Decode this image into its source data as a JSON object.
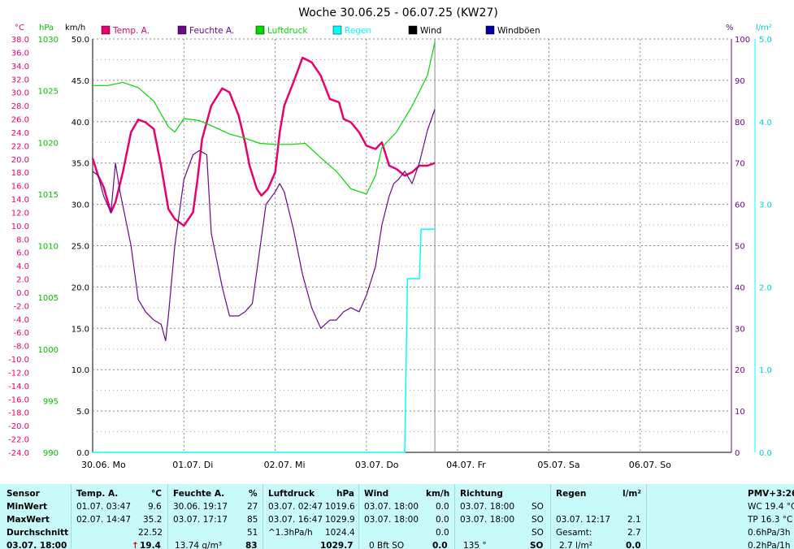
{
  "chart_data": {
    "type": "line",
    "title": "Woche 30.06.25 - 06.07.25 (KW27)",
    "axes": {
      "temperature": {
        "unit": "°C",
        "min": -24,
        "max": 38,
        "ticks": [
          "38.0",
          "36.0",
          "34.0",
          "32.0",
          "30.0",
          "28.0",
          "26.0",
          "24.0",
          "22.0",
          "20.0",
          "18.0",
          "16.0",
          "14.0",
          "12.0",
          "10.0",
          "8.0",
          "6.0",
          "4.0",
          "2.0",
          "0.0",
          "-2.0",
          "-4.0",
          "-6.0",
          "-8.0",
          "-10.0",
          "-12.0",
          "-14.0",
          "-16.0",
          "-18.0",
          "-20.0",
          "-22.0",
          "-24.0"
        ]
      },
      "pressure": {
        "unit": "hPa",
        "min": 990,
        "max": 1030,
        "ticks": [
          "1030",
          "1025",
          "1020",
          "1015",
          "1010",
          "1005",
          "1000",
          "995",
          "990"
        ]
      },
      "wind": {
        "unit": "km/h",
        "min": 0,
        "max": 50,
        "ticks": [
          "50.0",
          "45.0",
          "40.0",
          "35.0",
          "30.0",
          "25.0",
          "20.0",
          "15.0",
          "10.0",
          "5.0",
          "0.0"
        ]
      },
      "humidity": {
        "unit": "%",
        "min": 0,
        "max": 100,
        "ticks": [
          "100",
          "90",
          "80",
          "70",
          "60",
          "50",
          "40",
          "30",
          "20",
          "10",
          "0"
        ]
      },
      "rain": {
        "unit": "l/m²",
        "min": 0,
        "max": 5,
        "ticks": [
          "5.0",
          "4.0",
          "3.0",
          "2.0",
          "1.0",
          "0.0"
        ]
      }
    },
    "x_labels": [
      "30.06. Mo",
      "01.07. Di",
      "02.07. Mi",
      "03.07. Do",
      "04.07. Fr",
      "05.07. Sa",
      "06.07. So"
    ],
    "legend": [
      {
        "name": "Temp. A.",
        "color": "#e8006e"
      },
      {
        "name": "Feuchte A.",
        "color": "#6a0a8a"
      },
      {
        "name": "Luftdruck",
        "color": "#00d800"
      },
      {
        "name": "Regen",
        "color": "#00ffff"
      },
      {
        "name": "Wind",
        "color": "#000000"
      },
      {
        "name": "Windböen",
        "color": "#0000a0"
      }
    ],
    "series": [
      {
        "name": "Temp. A.",
        "axis": "temperature",
        "x": [
          0,
          0.06,
          0.12,
          0.2,
          0.25,
          0.33,
          0.42,
          0.5,
          0.58,
          0.67,
          0.75,
          0.83,
          0.9,
          1.0,
          1.1,
          1.15,
          1.2,
          1.3,
          1.42,
          1.5,
          1.6,
          1.67,
          1.72,
          1.8,
          1.85,
          1.92,
          2.0,
          2.05,
          2.1,
          2.2,
          2.3,
          2.4,
          2.5,
          2.6,
          2.7,
          2.75,
          2.83,
          2.92,
          3.0,
          3.1,
          3.17,
          3.25,
          3.33,
          3.42,
          3.5,
          3.58,
          3.67,
          3.75
        ],
        "y": [
          20.1,
          17.5,
          15.8,
          12.0,
          13.5,
          18.0,
          24.0,
          25.9,
          25.5,
          24.5,
          19.0,
          12.5,
          11.0,
          10.0,
          12.0,
          17.0,
          23.0,
          28.0,
          30.6,
          30.0,
          26.5,
          22.5,
          19.0,
          15.5,
          14.5,
          15.5,
          18.0,
          24.0,
          28.0,
          31.5,
          35.2,
          34.5,
          32.5,
          29.0,
          28.5,
          26.0,
          25.5,
          24.0,
          22.0,
          21.5,
          22.5,
          19.0,
          18.5,
          17.5,
          18.0,
          19.0,
          19.0,
          19.4
        ]
      },
      {
        "name": "Feuchte A.",
        "axis": "humidity",
        "x": [
          0,
          0.06,
          0.12,
          0.2,
          0.25,
          0.3,
          0.42,
          0.5,
          0.58,
          0.67,
          0.75,
          0.8,
          0.83,
          0.9,
          1.0,
          1.1,
          1.17,
          1.25,
          1.3,
          1.42,
          1.5,
          1.6,
          1.67,
          1.75,
          1.8,
          1.9,
          2.0,
          2.05,
          2.1,
          2.2,
          2.3,
          2.4,
          2.5,
          2.6,
          2.67,
          2.75,
          2.83,
          2.92,
          3.0,
          3.1,
          3.17,
          3.25,
          3.3,
          3.35,
          3.42,
          3.5,
          3.58,
          3.67,
          3.75
        ],
        "y": [
          68,
          67,
          62,
          58,
          70,
          63,
          50,
          37,
          34,
          32,
          31,
          27,
          33,
          50,
          66,
          72,
          73,
          72,
          53,
          40,
          33,
          33,
          34,
          36,
          44,
          60,
          63,
          65,
          63,
          54,
          43,
          35,
          30,
          32,
          32,
          34,
          35,
          34,
          38,
          45,
          55,
          62,
          65,
          66,
          68,
          65,
          70,
          78,
          83
        ]
      },
      {
        "name": "Luftdruck",
        "axis": "pressure",
        "x": [
          0,
          0.17,
          0.33,
          0.5,
          0.67,
          0.83,
          0.9,
          1.0,
          1.17,
          1.33,
          1.5,
          1.67,
          1.83,
          2.0,
          2.17,
          2.33,
          2.5,
          2.67,
          2.83,
          3.0,
          3.1,
          3.17,
          3.33,
          3.5,
          3.67,
          3.75
        ],
        "y": [
          1025.5,
          1025.5,
          1025.8,
          1025.3,
          1024.0,
          1021.5,
          1021.0,
          1022.3,
          1022.1,
          1021.5,
          1020.8,
          1020.4,
          1019.9,
          1019.8,
          1019.8,
          1019.9,
          1018.5,
          1017.2,
          1015.5,
          1015.0,
          1016.8,
          1019.5,
          1021.0,
          1023.5,
          1026.5,
          1029.7
        ]
      },
      {
        "name": "Regen",
        "axis": "rain",
        "x": [
          0,
          3.42,
          3.45,
          3.5,
          3.58,
          3.6,
          3.75
        ],
        "y": [
          0,
          0,
          2.1,
          2.1,
          2.1,
          2.7,
          2.7
        ]
      }
    ]
  },
  "header": {
    "temp_unit": "°C",
    "pressure_unit": "hPa",
    "wind_unit": "km/h",
    "humidity_unit": "%",
    "rain_unit": "l/m²"
  },
  "table": {
    "row_labels": {
      "sensor": "Sensor",
      "min": "MinWert",
      "max": "MaxWert",
      "avg": "Durchschnitt",
      "current": "03.07. 18:00"
    },
    "temp": {
      "title": "Temp. A.",
      "unit": "°C",
      "min_time": "01.07. 03:47",
      "min_val": "9.6",
      "max_time": "02.07. 14:47",
      "max_val": "35.2",
      "avg": "22.52",
      "current": "19.4",
      "trend": "up-arrow"
    },
    "hum": {
      "title": "Feuchte A.",
      "unit": "%",
      "min_time": "30.06. 19:17",
      "min_val": "27",
      "max_time": "03.07. 17:17",
      "max_val": "85",
      "avg": "51",
      "current_extra": "13.74 g/m³",
      "current": "83"
    },
    "press": {
      "title": "Luftdruck",
      "unit": "hPa",
      "min_time": "03.07. 02:47",
      "min_val": "1019.6",
      "max_time": "03.07. 16:47",
      "max_val": "1029.9",
      "avg_extra": "^1.3hPa/h",
      "avg": "1024.4",
      "current": "1029.7"
    },
    "wind": {
      "title": "Wind",
      "unit": "km/h",
      "min_time": "03.07. 18:00",
      "min_val": "0.0",
      "max_time": "03.07. 18:00",
      "max_val": "0.0",
      "avg": "0.0",
      "current_extra": "0 Bft SO",
      "current": "0.0"
    },
    "dir": {
      "title": "Richtung",
      "min_time": "03.07. 18:00",
      "min_val": "SO",
      "max_time": "03.07. 18:00",
      "max_val": "SO",
      "avg": "SO",
      "current_extra": "135 °",
      "current": "SO"
    },
    "rain": {
      "title": "Regen",
      "unit": "l/m²",
      "max_time": "03.07. 12:17",
      "max_val": "2.1",
      "total_label": "Gesamt:",
      "total_val": "2.7",
      "current_extra": "2.7 l/m²",
      "current": "0.0"
    },
    "pmv": {
      "title": "PMV+3:26",
      "line1": "WC 19.4 °C",
      "line2": "TP 16.3 °C",
      "line3": "0.6hPa/3h",
      "line4": "0.2hPa/1h"
    }
  },
  "colors": {
    "temp": "#e8006e",
    "humidity": "#6a0a8a",
    "pressure": "#00d800",
    "rain": "#00ffff",
    "wind": "#000000",
    "gusts": "#0000a0",
    "table_bg": "#c8fafa"
  }
}
